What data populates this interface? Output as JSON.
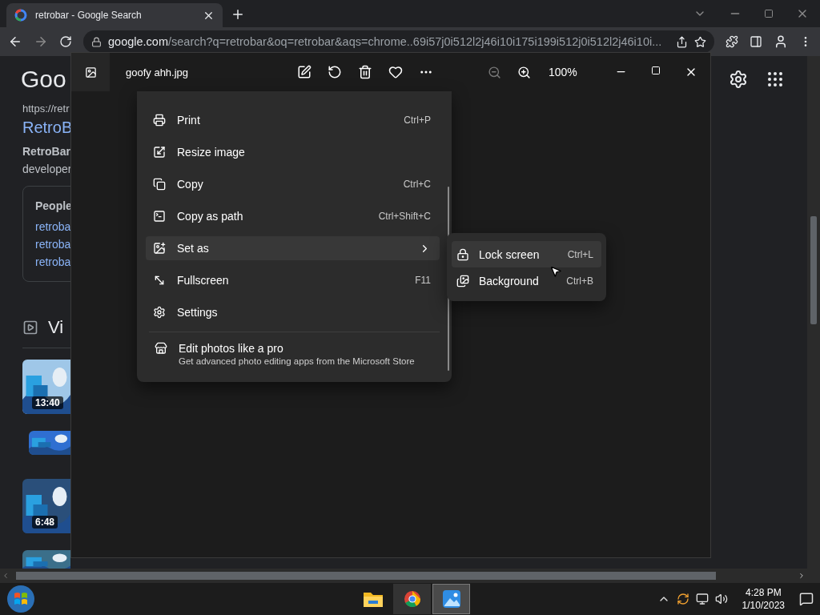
{
  "browser": {
    "tab": {
      "title": "retrobar - Google Search"
    },
    "address": {
      "domain": "google.com",
      "path": "/search?q=retrobar&oq=retrobar&aqs=chrome..69i57j0i512l2j46i10i175i199i512j0i512l2j46i10i..."
    }
  },
  "google": {
    "logo": "Goo",
    "result": {
      "url": "https://retr",
      "title": "RetroB",
      "snippet": [
        {
          "text": "RetroBar",
          "bold": true
        },
        {
          "text": "developer",
          "bold": false
        }
      ]
    },
    "people_also_search": {
      "title": "People",
      "links": [
        "retroba",
        "retroba",
        "retroba"
      ]
    },
    "videos": {
      "title": "Vi",
      "items": [
        {
          "kind": "large",
          "duration": "13:40"
        },
        {
          "kind": "small"
        },
        {
          "kind": "large",
          "duration": "6:48"
        },
        {
          "kind": "partial"
        }
      ]
    }
  },
  "photos": {
    "file_name": "goofy ahh.jpg",
    "zoom": "100%",
    "menu": {
      "items": [
        {
          "label": "Print",
          "shortcut": "Ctrl+P",
          "kind": "print",
          "highlighted": false
        },
        {
          "label": "Resize image",
          "kind": "resize",
          "highlighted": false
        },
        {
          "label": "Copy",
          "shortcut": "Ctrl+C",
          "kind": "copy",
          "highlighted": false
        },
        {
          "label": "Copy as path",
          "shortcut": "Ctrl+Shift+C",
          "kind": "path",
          "highlighted": false
        },
        {
          "label": "Set as",
          "kind": "submenu",
          "highlighted": true
        },
        {
          "label": "Fullscreen",
          "shortcut": "F11",
          "kind": "fullscreen",
          "highlighted": false
        },
        {
          "label": "Settings",
          "kind": "settings",
          "highlighted": false
        }
      ],
      "promo": {
        "title": "Edit photos like a pro",
        "subtitle": "Get advanced photo editing apps from the Microsoft Store"
      }
    },
    "submenu": [
      {
        "label": "Lock screen",
        "shortcut": "Ctrl+L",
        "kind": "lock",
        "highlighted": true
      },
      {
        "label": "Background",
        "shortcut": "Ctrl+B",
        "kind": "background",
        "highlighted": false
      }
    ]
  },
  "taskbar": {
    "apps": [
      {
        "kind": "files",
        "open": false,
        "selected": false
      },
      {
        "kind": "chrome",
        "open": true,
        "selected": false
      },
      {
        "kind": "photos",
        "open": true,
        "selected": true
      }
    ],
    "clock": {
      "time": "4:28 PM",
      "date": "1/10/2023"
    }
  }
}
